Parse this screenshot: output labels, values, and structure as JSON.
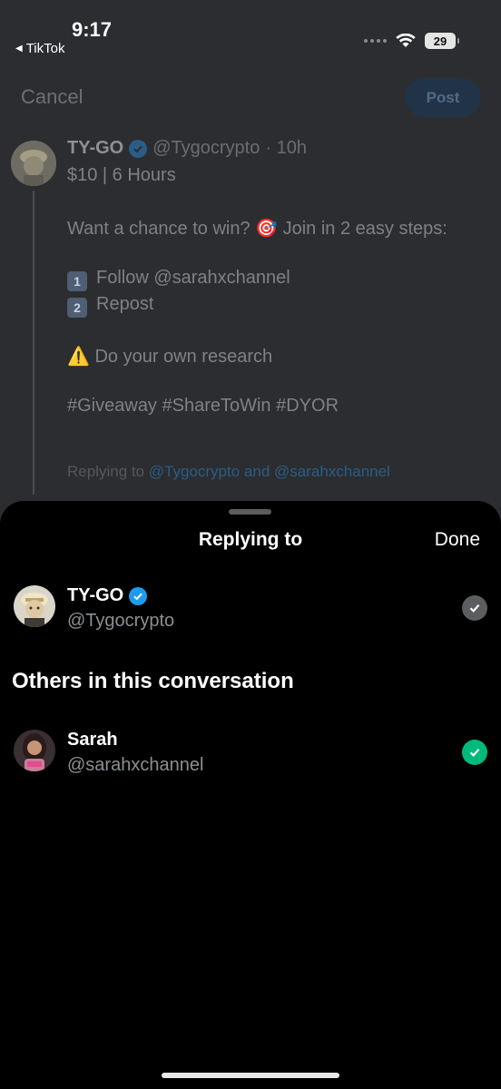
{
  "status_bar": {
    "time": "9:17",
    "back_app": "TikTok",
    "battery": "29"
  },
  "compose": {
    "cancel_label": "Cancel",
    "post_label": "Post"
  },
  "tweet": {
    "name": "TY-GO",
    "handle": "@Tygocrypto",
    "time": "· 10h",
    "lines": {
      "l1": "$10 | 6 Hours",
      "l2": "Want a chance to win? 🎯 Join in 2 easy steps:",
      "step1_num": "1",
      "step1_text": "Follow @sarahxchannel",
      "step2_num": "2",
      "step2_text": "Repost",
      "warning": "⚠️ Do your own research",
      "hashtags": "#Giveaway #ShareToWin #DYOR"
    },
    "replying_prefix": "Replying to ",
    "replying_targets": "@Tygocrypto and @sarahxchannel"
  },
  "sheet": {
    "title": "Replying to",
    "done_label": "Done",
    "primary": {
      "name": "TY-GO",
      "handle": "@Tygocrypto",
      "checked": true
    },
    "others_title": "Others in this conversation",
    "others": [
      {
        "name": "Sarah",
        "handle": "@sarahxchannel",
        "checked": true
      }
    ]
  },
  "colors": {
    "accent": "#1d9bf0",
    "check_green": "#00ba7c",
    "check_gray": "#5b5d60"
  }
}
